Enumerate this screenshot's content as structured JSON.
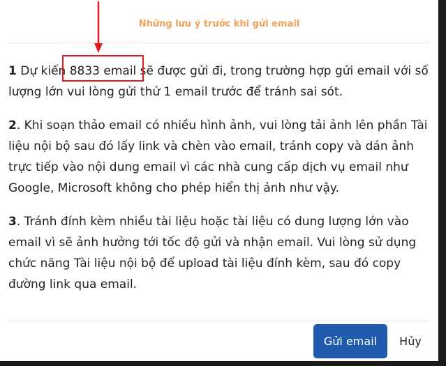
{
  "dialog": {
    "title": "Những lưu ý trước khi gửi email",
    "paragraphs": [
      {
        "number": "1",
        "pre": " Dự kiế",
        "highlight": "n 8833 email",
        "post": " sẽ được gửi đi, trong trường hợp gửi email với số lượng lớn vui lòng gửi thử 1 email trước để tránh sai sót."
      },
      {
        "number": "2",
        "text": ". Khi soạn thảo email có nhiều hình ảnh, vui lòng tải ảnh lên phần Tài liệu nội bộ sau đó lấy link và chèn vào email, tránh copy và dán ảnh trực tiếp vào nội dung email vì các nhà cung cấp dịch vụ email như Google, Microsoft không cho phép hiển thị ảnh như vậy."
      },
      {
        "number": "3",
        "text": ". Tránh đính kèm nhiều tài liệu hoặc tài liệu có dung lượng lớn vào email vì sẽ ảnh hưởng tới tốc độ gửi và nhận email. Vui lòng sử dụng chức năng Tài liệu nội bộ để upload tài liệu đính kèm, sau đó copy đường link qua email."
      }
    ],
    "submit_label": "Gửi email",
    "cancel_label": "Hủy"
  },
  "colors": {
    "title": "#f0a158",
    "primary_button": "#1f5cb0",
    "annotation": "#e21b1b"
  }
}
